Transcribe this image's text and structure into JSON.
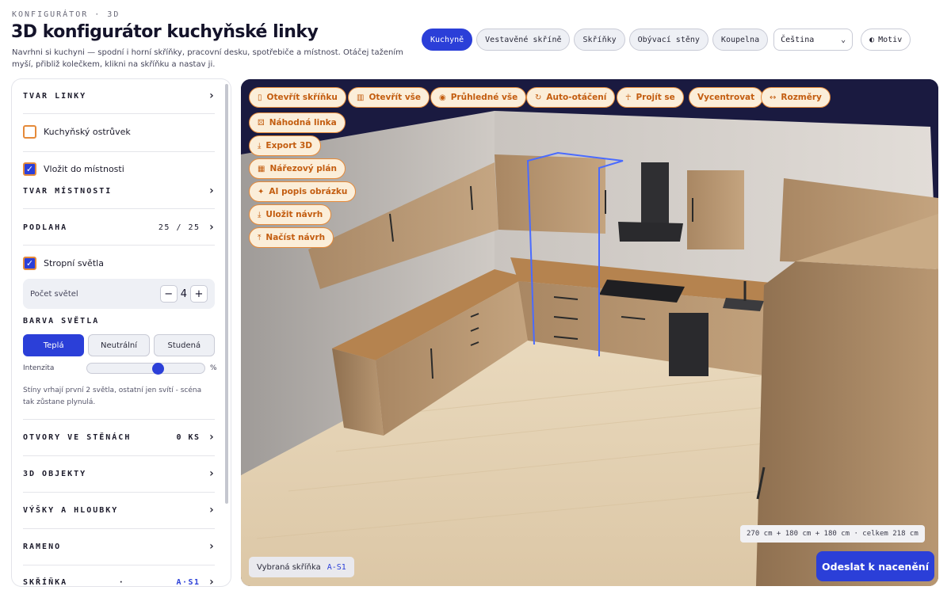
{
  "header": {
    "eyebrow": "KONFIGURÁTOR · 3D",
    "title": "3D konfigurátor kuchyňské linky",
    "subtitle": "Navrhni si kuchyni — spodní i horní skříňky, pracovní desku, spotřebiče a místnost. Otáčej tažením myší, přibliž kolečkem, klikni na skříňku a nastav ji."
  },
  "nav": {
    "tabs": [
      "Kuchyně",
      "Vestavěné skříně",
      "Skříňky",
      "Obývací stěny",
      "Koupelna"
    ],
    "active": "Kuchyně",
    "language": "Čeština",
    "theme_label": "Motiv"
  },
  "sidebar": {
    "shape_label": "TVAR LINKY",
    "island_label": "Kuchyňský ostrůvek",
    "island_checked": false,
    "room_label": "Vložit do místnosti",
    "room_checked": true,
    "room_shape_label": "TVAR MÍSTNOSTI",
    "floor_label": "PODLAHA",
    "floor_value": "25 / 25",
    "ceiling_lights_label": "Stropní světla",
    "ceiling_lights_checked": true,
    "light_count_label": "Počet světel",
    "light_count": "4",
    "light_color_label": "BARVA SVĚTLA",
    "light_colors": [
      "Teplá",
      "Neutrální",
      "Studená"
    ],
    "light_color_active": "Teplá",
    "intensity_label": "Intenzita",
    "intensity_unit": "%",
    "intensity_value": 0.6,
    "light_note": "Stíny vrhají první 2 světla, ostatní jen svítí - scéna tak zůstane plynulá.",
    "openings_label": "OTVORY VE STĚNÁCH",
    "openings_value": "0 KS",
    "objects_label": "3D OBJEKTY",
    "heights_label": "VÝŠKY A HLOUBKY",
    "arm_label": "RAMENO",
    "cabinet_label": "SKŘÍŇKA",
    "cabinet_sep": "·",
    "cabinet_value": "A·S1"
  },
  "viewport": {
    "tools": [
      {
        "label": "Otevřít skříňku",
        "icon": "cabinet-icon"
      },
      {
        "label": "Otevřít vše",
        "icon": "columns-icon"
      },
      {
        "label": "Průhledné vše",
        "icon": "eye-icon"
      },
      {
        "label": "Auto-otáčení",
        "icon": "rotate-icon"
      },
      {
        "label": "Projít se",
        "icon": "walk-icon"
      },
      {
        "label": "Vycentrovat",
        "icon": "center-icon"
      },
      {
        "label": "Rozměry",
        "icon": "ruler-icon"
      },
      {
        "label": "Náhodná linka",
        "icon": "dice-icon"
      },
      {
        "label": "Export 3D",
        "icon": "download-icon"
      },
      {
        "label": "Nářezový plán",
        "icon": "grid-icon"
      },
      {
        "label": "AI popis obrázku",
        "icon": "sparkle-icon"
      },
      {
        "label": "Uložit návrh",
        "icon": "save-icon"
      },
      {
        "label": "Načíst návrh",
        "icon": "upload-icon"
      }
    ],
    "dimensions": "270 cm + 180 cm + 180 cm · celkem 218 cm",
    "selected_label": "Vybraná skříňka",
    "selected_code": "A-S1",
    "cta_label": "Odeslat k nacenění"
  },
  "colors": {
    "accent": "#2b3fd8",
    "orange": "#e58a3a",
    "viewport_bg": "#1a1a40",
    "wood": "#b48c62",
    "floor": "#e6d3b5"
  }
}
